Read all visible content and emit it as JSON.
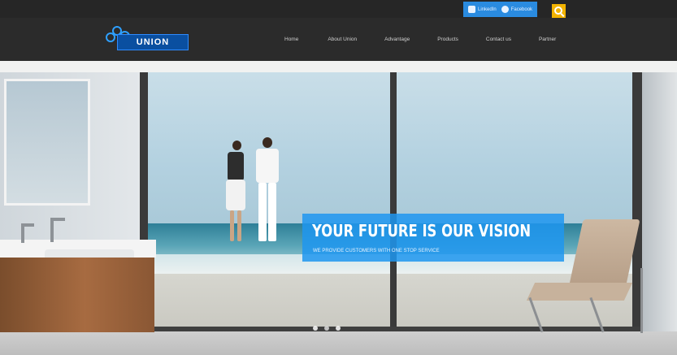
{
  "topbar": {
    "social": [
      {
        "label": "LinkedIn",
        "icon": "linkedin-icon"
      },
      {
        "label": "Facebook",
        "icon": "facebook-icon"
      }
    ],
    "search_icon": "search-icon"
  },
  "nav": {
    "logo_text": "UNION",
    "items": [
      "Home",
      "About Union",
      "Advantage",
      "Products",
      "Contact us",
      "Partner"
    ]
  },
  "hero": {
    "title": "YOUR FUTURE IS OUR VISION",
    "subtitle": "WE PROVIDE CUSTOMERS WITH ONE STOP SERVICE",
    "slides": 3,
    "active_slide": 2
  },
  "colors": {
    "accent": "#2a8be0",
    "search": "#f2b300",
    "nav_bg": "#2b2b2b"
  }
}
